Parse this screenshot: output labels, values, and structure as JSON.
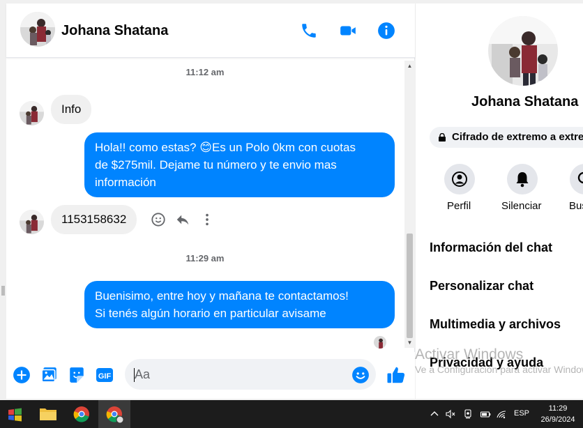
{
  "conversation": {
    "contact_name": "Johana Shatana"
  },
  "messages": [
    {
      "type": "timestamp",
      "text": "11:12 am"
    },
    {
      "type": "incoming",
      "text": "Info"
    },
    {
      "type": "outgoing",
      "lines": [
        "Hola!! como estas? 😊Es un Polo 0km con cuotas",
        "de $275mil. Dejame tu número y te envio mas",
        "información"
      ]
    },
    {
      "type": "incoming",
      "text": "1153158632"
    },
    {
      "type": "timestamp",
      "text": "11:29 am"
    },
    {
      "type": "outgoing",
      "lines": [
        "Buenisimo, entre hoy y mañana te contactamos!",
        "Si tenés algún horario en particular avisame"
      ]
    }
  ],
  "composer": {
    "placeholder": "Aa",
    "gif_label": "GIF"
  },
  "info_panel": {
    "name": "Johana Shatana",
    "encryption_label": "Cifrado de extremo a extremo",
    "actions": [
      {
        "label": "Perfil",
        "icon": "profile-icon"
      },
      {
        "label": "Silenciar",
        "icon": "bell-icon"
      },
      {
        "label": "Buscar",
        "icon": "search-icon"
      }
    ],
    "sections": [
      "Información del chat",
      "Personalizar chat",
      "Multimedia y archivos",
      "Privacidad y ayuda"
    ]
  },
  "watermark": {
    "title": "Activar Windows",
    "subtitle": "Ve a Configuración para activar Windows."
  },
  "taskbar": {
    "language": "ESP",
    "time": "11:29",
    "date": "26/9/2024"
  },
  "colors": {
    "accent": "#0084ff",
    "outgoing_bubble": "#0084ff",
    "incoming_bubble": "#f0f0f0"
  }
}
